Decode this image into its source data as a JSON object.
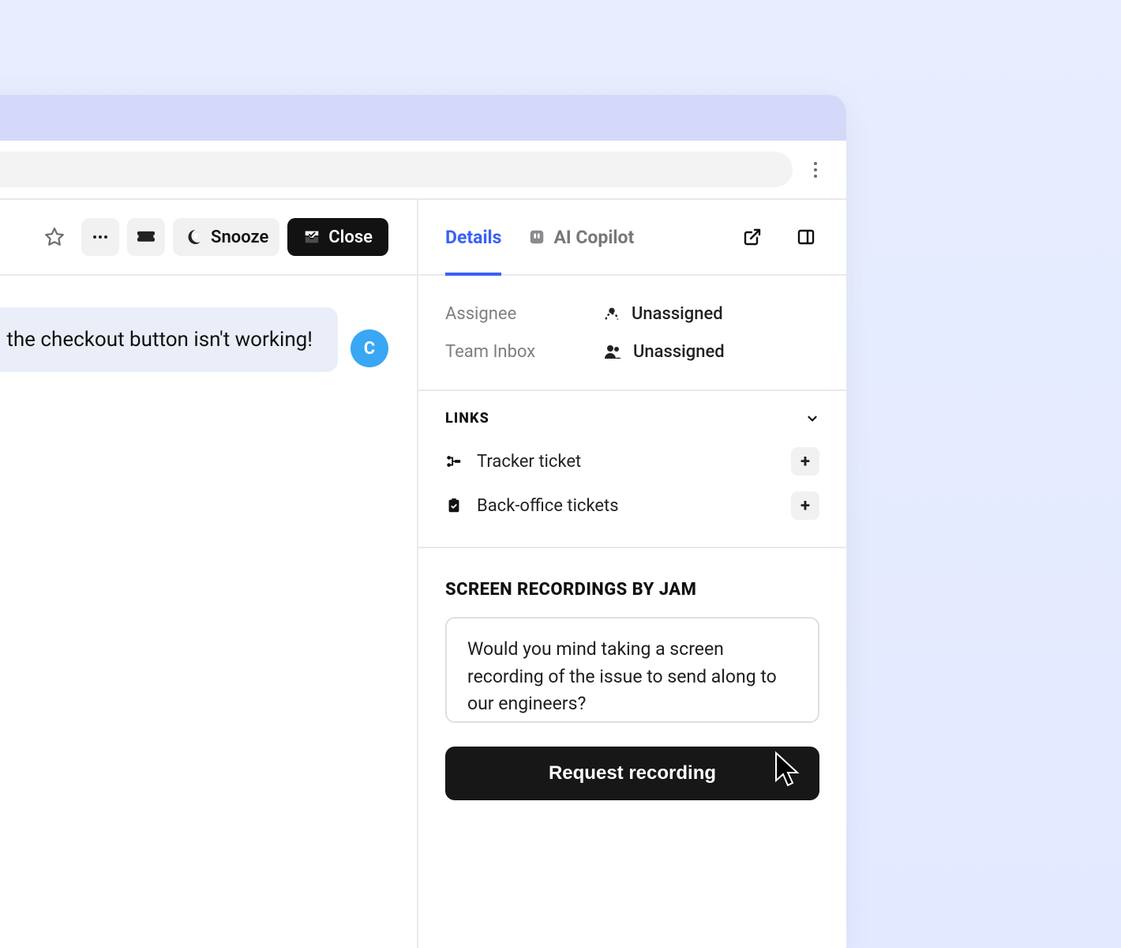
{
  "toolbar": {
    "snooze_label": "Snooze",
    "close_label": "Close"
  },
  "conversation": {
    "message": "the checkout button isn't working!",
    "avatar_initial": "C"
  },
  "sidebar": {
    "tabs": {
      "details": "Details",
      "ai_copilot": "AI Copilot"
    },
    "assignee_label": "Assignee",
    "assignee_value": "Unassigned",
    "team_inbox_label": "Team Inbox",
    "team_inbox_value": "Unassigned",
    "links_header": "LINKS",
    "links": {
      "tracker": "Tracker ticket",
      "backoffice": "Back-office tickets"
    },
    "recordings": {
      "title": "SCREEN RECORDINGS BY JAM",
      "message": "Would you mind taking a screen recording of the issue to send along to our engineers?",
      "button": "Request recording"
    }
  }
}
